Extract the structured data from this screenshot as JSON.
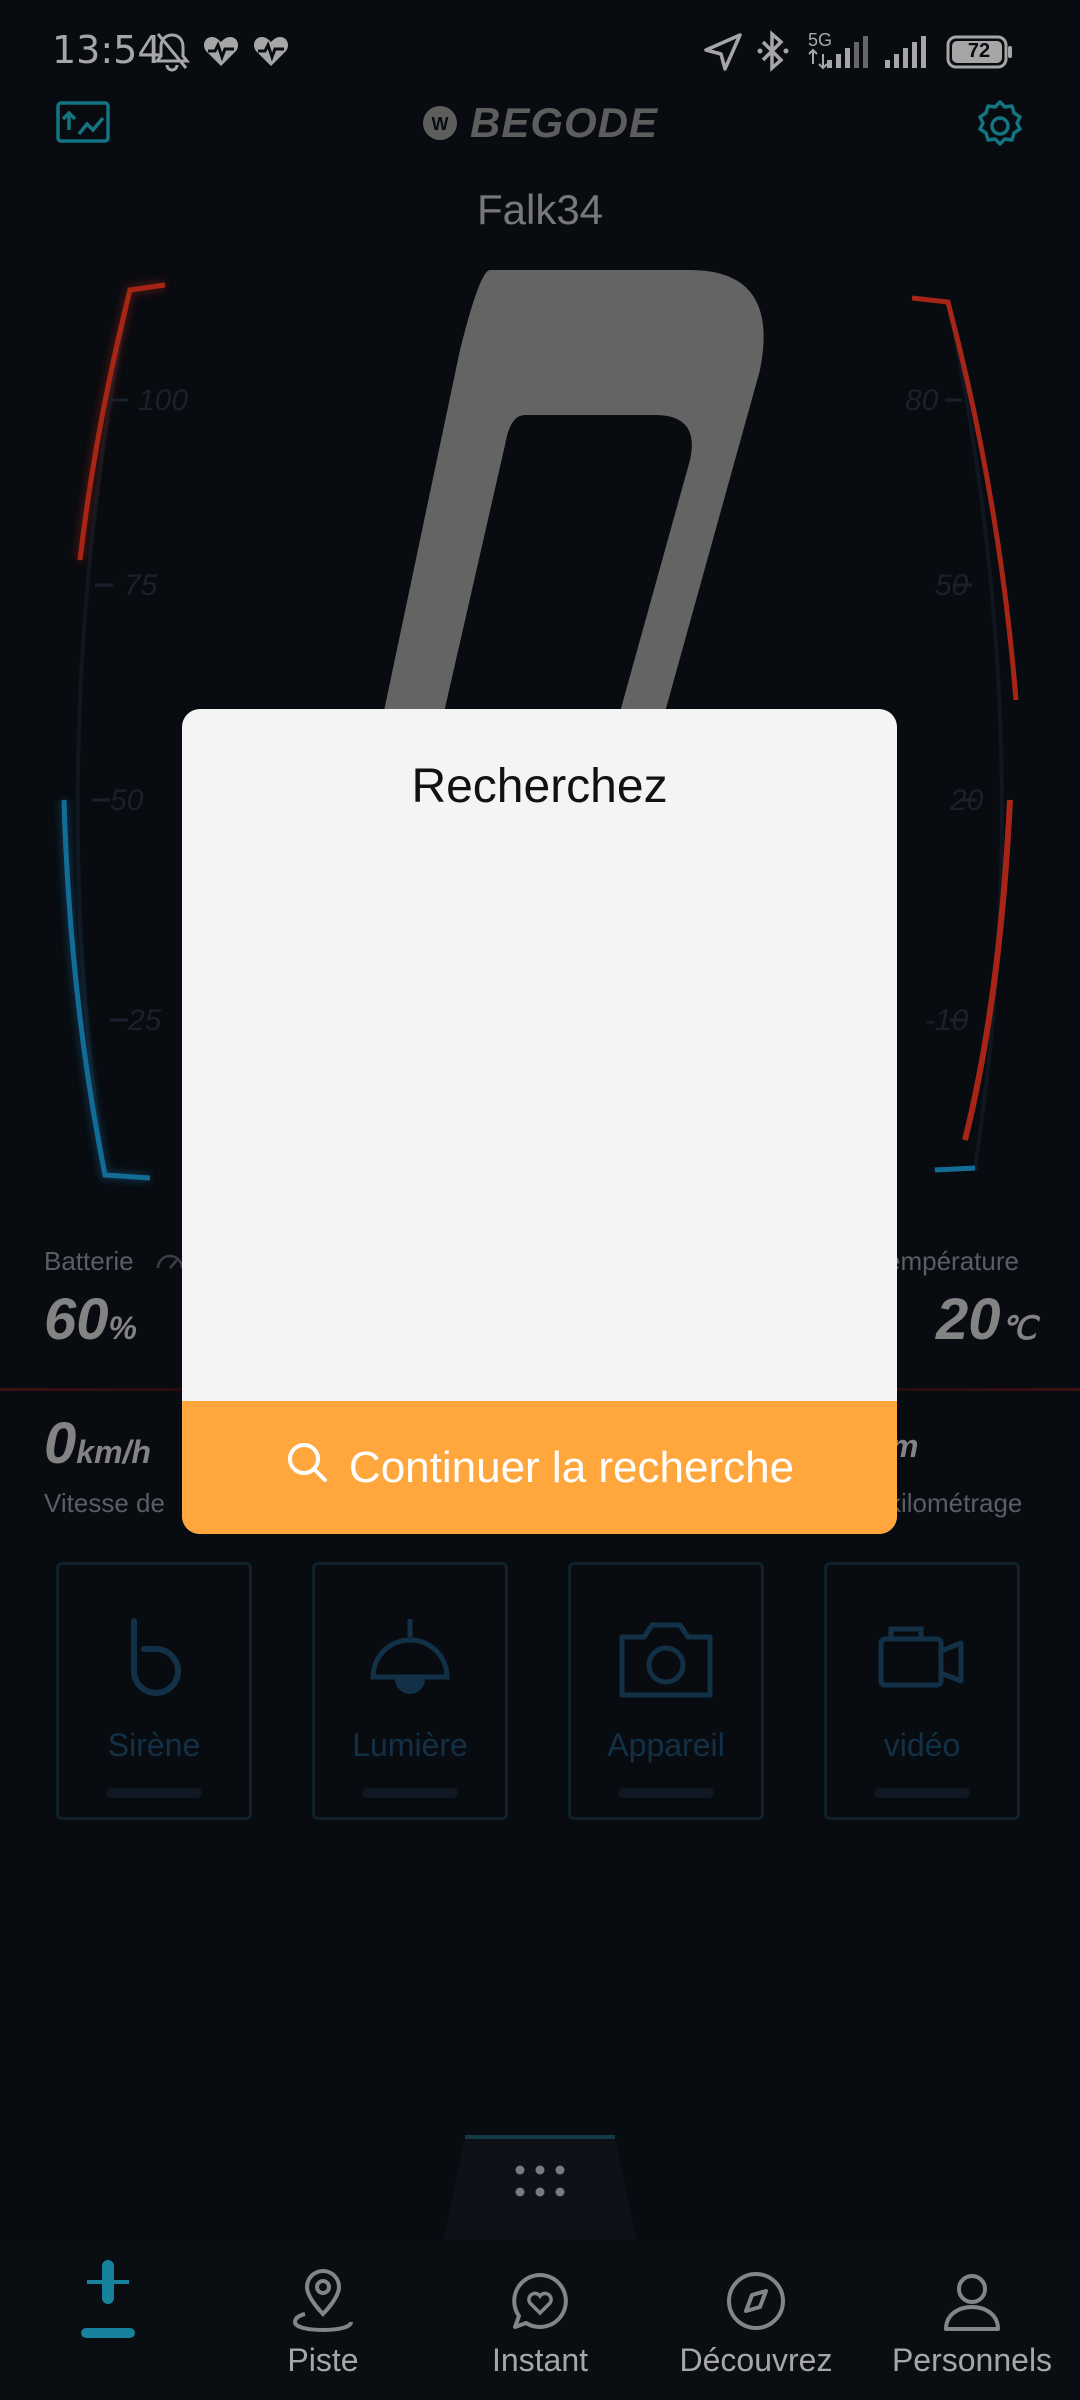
{
  "status_bar": {
    "time": "13:54",
    "network_label": "5G",
    "battery_level": "72",
    "icons": [
      "bell-off-icon",
      "heart-pulse-icon",
      "heart-pulse-icon",
      "location-arrow-icon",
      "bluetooth-icon",
      "signal-icon",
      "signal-icon",
      "battery-icon"
    ]
  },
  "header": {
    "brand": "BEGODE",
    "device_name": "Falk34",
    "left_icon": "upload-chart-icon",
    "right_icon": "gear-icon",
    "accent_color": "#1fb3c8"
  },
  "gauge": {
    "speed": "0",
    "left_ticks": [
      "100",
      "75",
      "50",
      "25"
    ],
    "right_ticks": [
      "80",
      "50",
      "20",
      "-10"
    ]
  },
  "stats": {
    "battery_label": "Batterie",
    "battery_value": "60",
    "battery_unit": "%",
    "temperature_label": "empérature",
    "temperature_value": "20",
    "temperature_unit": "℃",
    "speed_value": "0",
    "speed_unit": "km/h",
    "speed_label": "Vitesse de",
    "mileage_unit": "m",
    "mileage_label": "kilométrage"
  },
  "tiles": [
    {
      "label": "Sirène",
      "icon": "horn-icon"
    },
    {
      "label": "Lumière",
      "icon": "lamp-icon"
    },
    {
      "label": "Appareil",
      "icon": "camera-icon"
    },
    {
      "label": "vidéo",
      "icon": "video-camera-icon"
    }
  ],
  "bottom_nav": [
    {
      "label": "",
      "icon": "unicycle-icon",
      "active": true
    },
    {
      "label": "Piste",
      "icon": "location-pin-icon"
    },
    {
      "label": "Instant",
      "icon": "chat-heart-icon"
    },
    {
      "label": "Découvrez",
      "icon": "compass-icon"
    },
    {
      "label": "Personnels",
      "icon": "person-icon"
    }
  ],
  "dialog": {
    "title": "Recherchez",
    "button_label": "Continuer la recherche",
    "button_icon": "search-icon",
    "button_color": "#ffa63d"
  }
}
